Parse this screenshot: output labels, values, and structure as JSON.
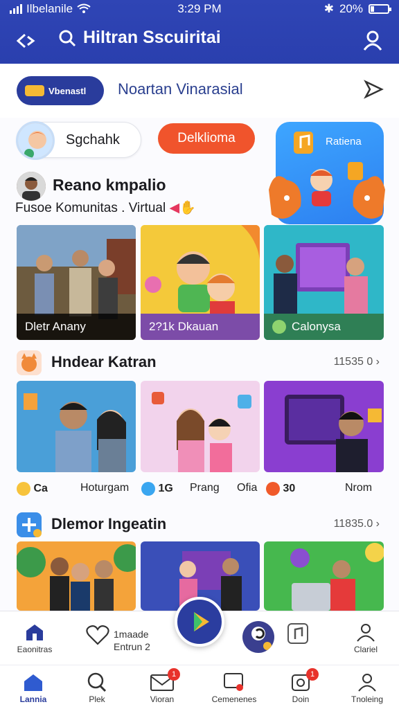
{
  "status_bar": {
    "carrier": "Ilbelanile",
    "time": "3:29 PM",
    "battery": "20%"
  },
  "header": {
    "search_title": "Hiltran Sscuiritai"
  },
  "strip": {
    "chip_label": "Vbenastl",
    "title": "Noartan Vinarasial"
  },
  "top_row": {
    "user_label": "Sgchahk",
    "orange_button": "Delklioma",
    "promo_label": "Ratiena"
  },
  "section1": {
    "title": "Reano kmpalio",
    "subtitle": "Fusoe Komunitas . Virtual",
    "cards": [
      {
        "caption": "Dletr Anany"
      },
      {
        "caption": "2?1k Dkauan"
      },
      {
        "caption": "Calonysa"
      }
    ]
  },
  "section2": {
    "title": "Hndear Katran",
    "more": "11535 0",
    "meta": [
      "Ca",
      "Hoturgam",
      "1G",
      "Prang",
      "Ofia",
      "30",
      "Nrom"
    ]
  },
  "section3": {
    "title": "Dlemor Ingeatin",
    "more": "11835.0"
  },
  "bottom_bar_1": {
    "home_label": "Eaonitras",
    "mid_label_1": "1maade",
    "mid_label_2": "Entrun 2",
    "profile_label": "Clariel"
  },
  "bottom_bar_2": [
    {
      "label": "Lannia"
    },
    {
      "label": "Plek"
    },
    {
      "label": "Vioran",
      "badge": "1"
    },
    {
      "label": "Cemenenes"
    },
    {
      "label": "Doin",
      "badge": "1"
    },
    {
      "label": "Tnoleing"
    }
  ],
  "colors": {
    "brand": "#2f45b5",
    "accent": "#f0542c",
    "promo": "#3ea6ff"
  }
}
